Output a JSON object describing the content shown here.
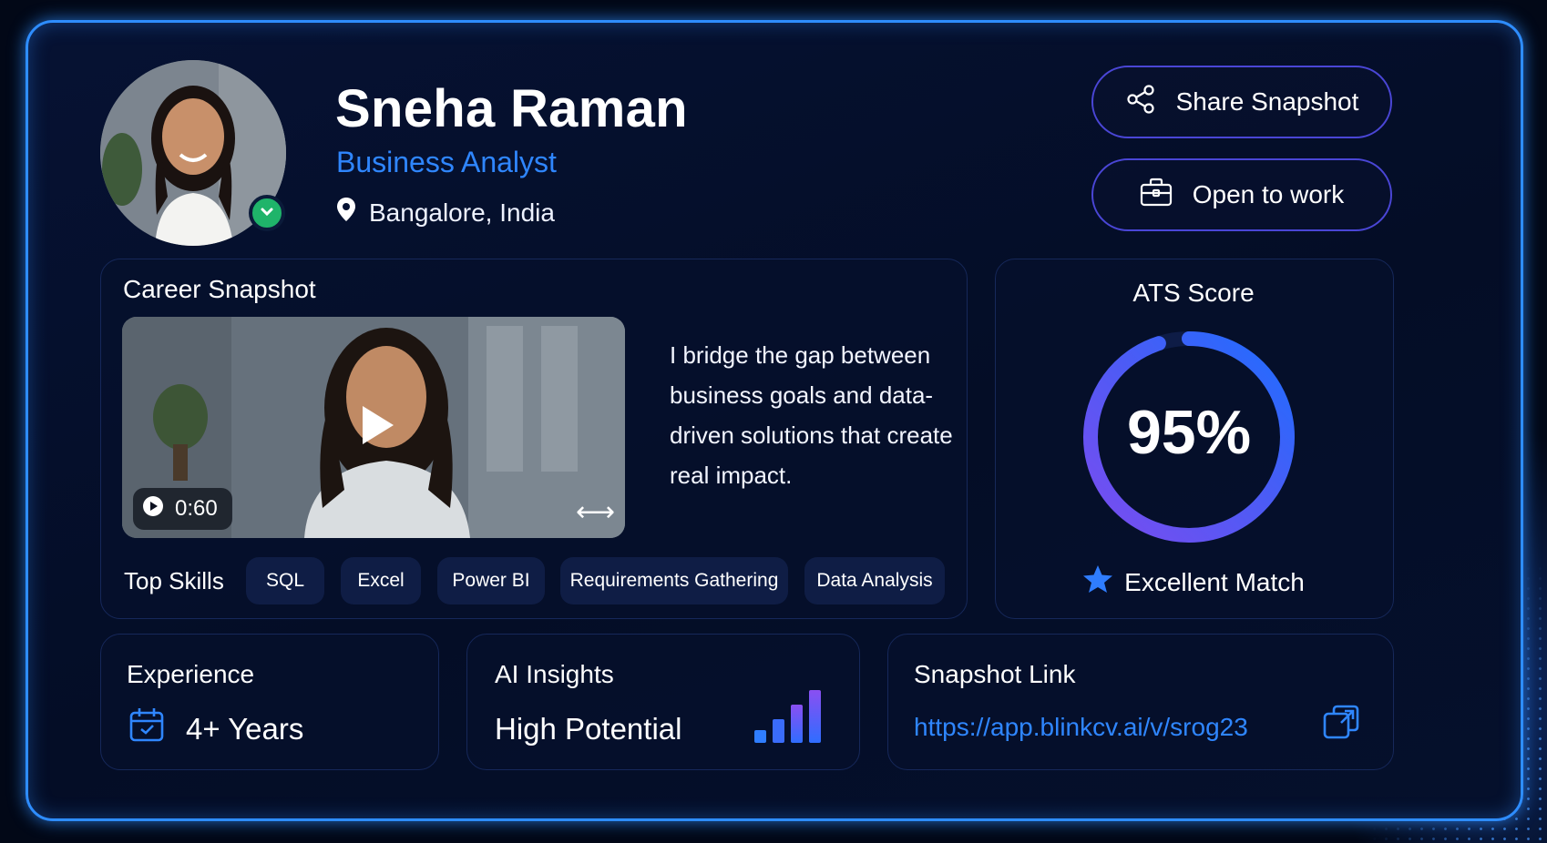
{
  "profile": {
    "name": "Sneha Raman",
    "role": "Business Analyst",
    "location": "Bangalore, India",
    "verified_icon": "check-circle-icon"
  },
  "actions": {
    "share_label": "Share Snapshot",
    "open_to_work_label": "Open to work"
  },
  "career": {
    "title": "Career Snapshot",
    "video_duration": "0:60",
    "bio": "I bridge the gap between business goals and data-driven solutions that create real impact.",
    "skills_label": "Top Skills",
    "skills": [
      "SQL",
      "Excel",
      "Power BI",
      "Requirements Gathering",
      "Data Analysis"
    ]
  },
  "ats": {
    "title": "ATS Score",
    "score": "95%",
    "score_fraction": 0.95,
    "match_label": "Excellent Match"
  },
  "experience": {
    "label": "Experience",
    "value": "4+ Years"
  },
  "insights": {
    "label": "AI Insights",
    "value": "High Potential"
  },
  "snapshot_link": {
    "label": "Snapshot Link",
    "url": "https://app.blinkcv.ai/v/srog23"
  },
  "colors": {
    "accent_blue": "#2f86ff",
    "accent_purple": "#7a4cf0",
    "verified_green": "#1fb46a",
    "background": "#020817"
  }
}
